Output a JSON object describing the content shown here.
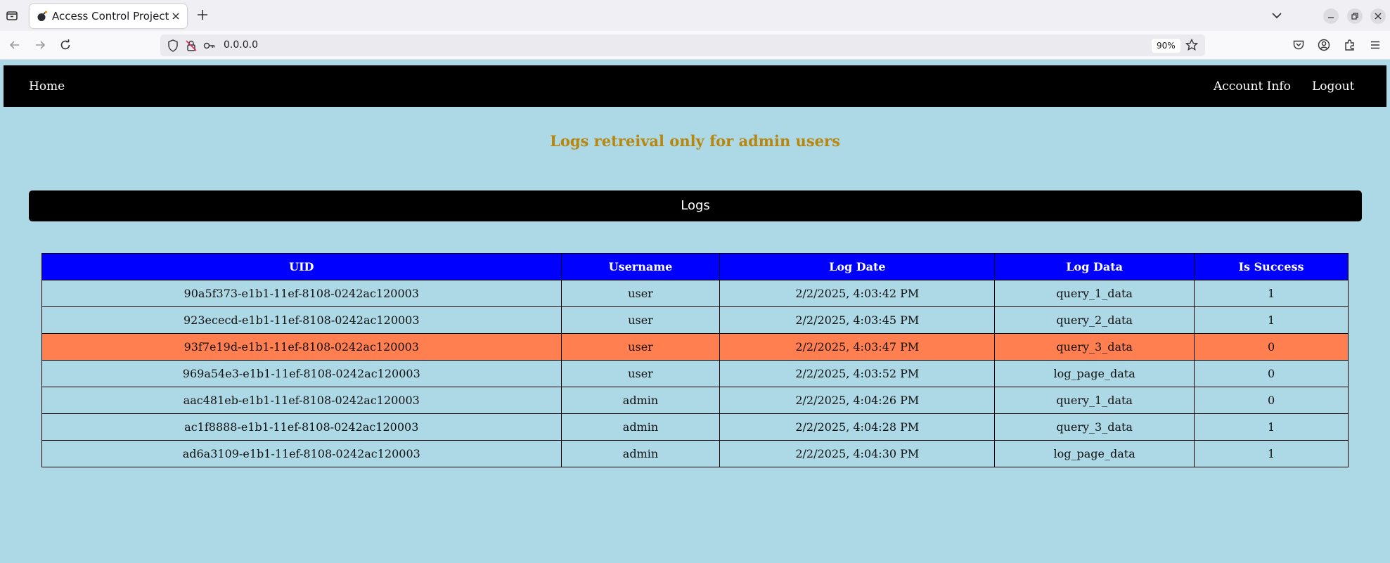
{
  "browser": {
    "tab_title": "Access Control Project",
    "url": "0.0.0.0",
    "zoom": "90%"
  },
  "site_nav": {
    "home": "Home",
    "account_info": "Account Info",
    "logout": "Logout"
  },
  "page": {
    "heading": "Logs retreival only for admin users",
    "logs_title": "Logs"
  },
  "table": {
    "headers": {
      "uid": "UID",
      "username": "Username",
      "log_date": "Log Date",
      "log_data": "Log Data",
      "is_success": "Is Success"
    },
    "rows": [
      {
        "uid": "90a5f373-e1b1-11ef-8108-0242ac120003",
        "username": "user",
        "log_date": "2/2/2025, 4:03:42 PM",
        "log_data": "query_1_data",
        "is_success": "1",
        "highlight": false
      },
      {
        "uid": "923ececd-e1b1-11ef-8108-0242ac120003",
        "username": "user",
        "log_date": "2/2/2025, 4:03:45 PM",
        "log_data": "query_2_data",
        "is_success": "1",
        "highlight": false
      },
      {
        "uid": "93f7e19d-e1b1-11ef-8108-0242ac120003",
        "username": "user",
        "log_date": "2/2/2025, 4:03:47 PM",
        "log_data": "query_3_data",
        "is_success": "0",
        "highlight": true
      },
      {
        "uid": "969a54e3-e1b1-11ef-8108-0242ac120003",
        "username": "user",
        "log_date": "2/2/2025, 4:03:52 PM",
        "log_data": "log_page_data",
        "is_success": "0",
        "highlight": false
      },
      {
        "uid": "aac481eb-e1b1-11ef-8108-0242ac120003",
        "username": "admin",
        "log_date": "2/2/2025, 4:04:26 PM",
        "log_data": "query_1_data",
        "is_success": "0",
        "highlight": false
      },
      {
        "uid": "ac1f8888-e1b1-11ef-8108-0242ac120003",
        "username": "admin",
        "log_date": "2/2/2025, 4:04:28 PM",
        "log_data": "query_3_data",
        "is_success": "1",
        "highlight": false
      },
      {
        "uid": "ad6a3109-e1b1-11ef-8108-0242ac120003",
        "username": "admin",
        "log_date": "2/2/2025, 4:04:30 PM",
        "log_data": "log_page_data",
        "is_success": "1",
        "highlight": false
      }
    ]
  },
  "colors": {
    "page_background": "#add8e6",
    "header_background": "#0000ff",
    "heading_text": "#b8860b",
    "highlight_row": "#ff7f50"
  }
}
